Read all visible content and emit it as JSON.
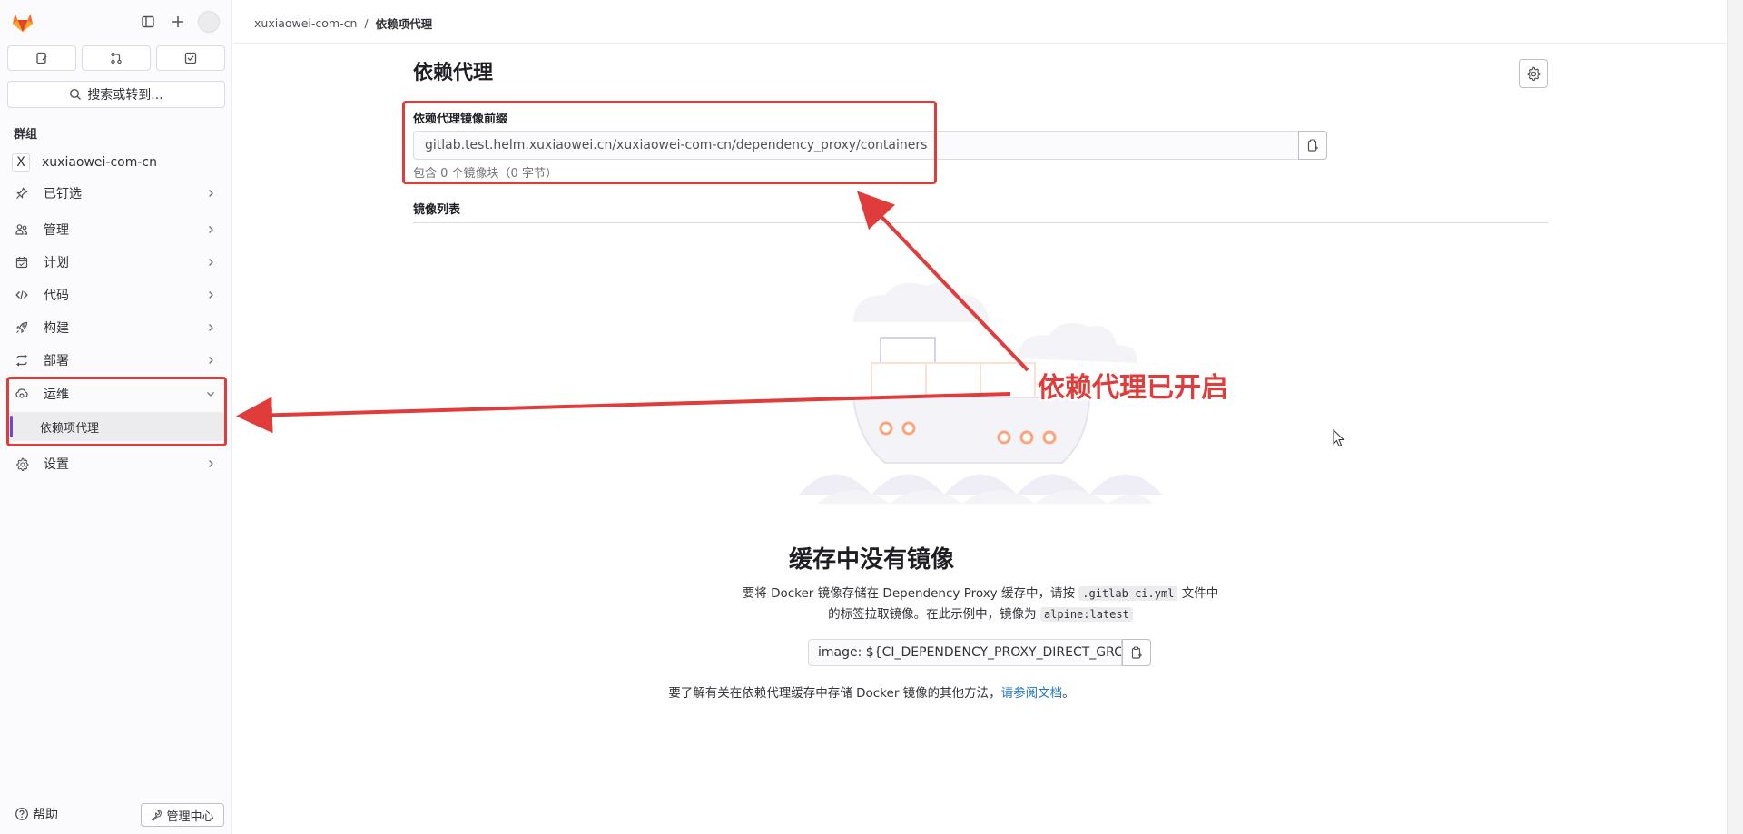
{
  "sidebar": {
    "quick_actions": [
      "issues-icon",
      "merge-requests-icon",
      "todos-icon"
    ],
    "search_label": "搜索或转到...",
    "section_label": "群组",
    "group_badge": "X",
    "group_name": "xuxiaowei-com-cn",
    "items": [
      {
        "label": "已钉选",
        "icon": "pin-icon"
      },
      {
        "label": "管理",
        "icon": "users-icon"
      },
      {
        "label": "计划",
        "icon": "calendar-icon"
      },
      {
        "label": "代码",
        "icon": "code-icon"
      },
      {
        "label": "构建",
        "icon": "rocket-icon"
      },
      {
        "label": "部署",
        "icon": "deploy-icon"
      },
      {
        "label": "运维",
        "icon": "monitor-icon"
      },
      {
        "label": "设置",
        "icon": "gear-icon"
      }
    ],
    "active_sub_item": "依赖项代理",
    "help_label": "帮助",
    "admin_label": "管理中心"
  },
  "breadcrumb": {
    "group": "xuxiaowei-com-cn",
    "separator": "/",
    "current": "依赖项代理"
  },
  "main": {
    "title": "依赖代理",
    "prefix_label": "依赖代理镜像前缀",
    "prefix_value": "gitlab.test.helm.xuxiaowei.cn/xuxiaowei-com-cn/dependency_proxy/containers",
    "prefix_hint": "包含 0 个镜像块（0 字节）",
    "list_title": "镜像列表",
    "empty_title": "缓存中没有镜像",
    "empty_desc_1": "要将 Docker 镜像存储在 Dependency Proxy 缓存中，请按",
    "empty_desc_code1": ".gitlab-ci.yml",
    "empty_desc_2": "文件中",
    "empty_desc_3": "的标签拉取镜像。在此示例中，镜像为",
    "empty_desc_code2": "alpine:latest",
    "snippet": "image: ${CI_DEPENDENCY_PROXY_DIRECT_GRC",
    "more_info_prefix": "要了解有关在依赖代理缓存中存储 Docker 镜像的其他方法，",
    "more_info_link": "请参阅文档",
    "more_info_suffix": "。"
  },
  "annotation": {
    "text": "依赖代理已开启",
    "color": "#e03c3c"
  },
  "colors": {
    "accent": "#6e49cb",
    "link": "#1f75cb",
    "annotation_red": "#e03c3c"
  }
}
